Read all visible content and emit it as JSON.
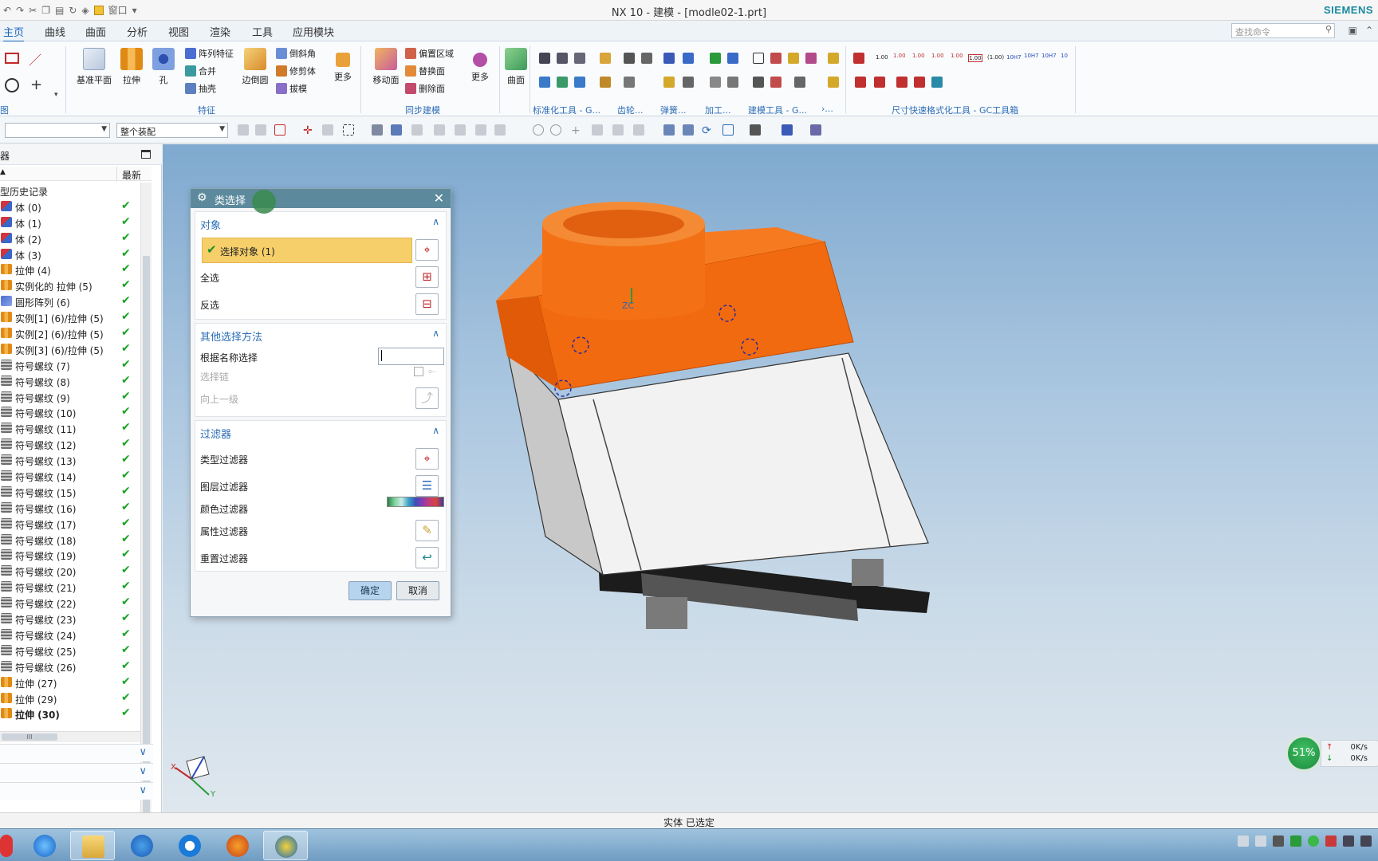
{
  "window": {
    "title": "NX 10 - 建模 - [modle02-1.prt]",
    "brand": "SIEMENS",
    "quick_access_menu": "窗口"
  },
  "menu": {
    "tabs": [
      "主页",
      "曲线",
      "曲面",
      "分析",
      "视图",
      "渲染",
      "工具",
      "应用模块"
    ],
    "active_tab": "主页",
    "search_placeholder": "查找命令"
  },
  "ribbon": {
    "buttons": {
      "datum_plane": "基准平面",
      "extrude": "拉伸",
      "hole": "孔",
      "pattern_feature": "阵列特征",
      "unite": "合并",
      "shell": "抽壳",
      "edge_blend": "边倒圆",
      "chamfer": "倒斜角",
      "trim_body": "修剪体",
      "draft": "拔模",
      "more_feature": "更多",
      "move_face": "移动面",
      "offset_region": "偏置区域",
      "replace_face": "替换面",
      "delete_face": "删除面",
      "more_sync": "更多",
      "surface": "曲面"
    },
    "groups": {
      "direct_sketch": "图",
      "feature": "特征",
      "sync_modeling": "同步建模",
      "std_tools": "标准化工具 - G...",
      "gear": "齿轮...",
      "spring": "弹簧...",
      "machining": "加工...",
      "modeling_tools": "建模工具 - G...",
      "misc": "›...",
      "dim_format": "尺寸快速格式化工具 - GC工具箱"
    },
    "dim_labels": [
      "1.00",
      "1.00",
      "1.00",
      "1.00",
      "1.00",
      "1.00",
      "(1.00)",
      "10H7",
      "10H7",
      "10H7",
      "10"
    ]
  },
  "selection_bar": {
    "filter_value": "",
    "scope_value": "整个装配"
  },
  "navigator": {
    "title": "器",
    "column_name": "▲",
    "column_latest": "最新",
    "root": "型历史记录",
    "items": [
      {
        "label": "体 (0)",
        "type": "body"
      },
      {
        "label": "体 (1)",
        "type": "body"
      },
      {
        "label": "体 (2)",
        "type": "body"
      },
      {
        "label": "体 (3)",
        "type": "body"
      },
      {
        "label": "拉伸 (4)",
        "type": "extrude"
      },
      {
        "label": "实例化的 拉伸 (5)",
        "type": "extrude"
      },
      {
        "label": "圆形阵列 (6)",
        "type": "pattern"
      },
      {
        "label": "实例[1] (6)/拉伸 (5)",
        "type": "extrude"
      },
      {
        "label": "实例[2] (6)/拉伸 (5)",
        "type": "extrude"
      },
      {
        "label": "实例[3] (6)/拉伸 (5)",
        "type": "extrude"
      },
      {
        "label": "符号螺纹 (7)",
        "type": "thread"
      },
      {
        "label": "符号螺纹 (8)",
        "type": "thread"
      },
      {
        "label": "符号螺纹 (9)",
        "type": "thread"
      },
      {
        "label": "符号螺纹 (10)",
        "type": "thread"
      },
      {
        "label": "符号螺纹 (11)",
        "type": "thread"
      },
      {
        "label": "符号螺纹 (12)",
        "type": "thread"
      },
      {
        "label": "符号螺纹 (13)",
        "type": "thread"
      },
      {
        "label": "符号螺纹 (14)",
        "type": "thread"
      },
      {
        "label": "符号螺纹 (15)",
        "type": "thread"
      },
      {
        "label": "符号螺纹 (16)",
        "type": "thread"
      },
      {
        "label": "符号螺纹 (17)",
        "type": "thread"
      },
      {
        "label": "符号螺纹 (18)",
        "type": "thread"
      },
      {
        "label": "符号螺纹 (19)",
        "type": "thread"
      },
      {
        "label": "符号螺纹 (20)",
        "type": "thread"
      },
      {
        "label": "符号螺纹 (21)",
        "type": "thread"
      },
      {
        "label": "符号螺纹 (22)",
        "type": "thread"
      },
      {
        "label": "符号螺纹 (23)",
        "type": "thread"
      },
      {
        "label": "符号螺纹 (24)",
        "type": "thread"
      },
      {
        "label": "符号螺纹 (25)",
        "type": "thread"
      },
      {
        "label": "符号螺纹 (26)",
        "type": "thread"
      },
      {
        "label": "拉伸 (27)",
        "type": "extrude"
      },
      {
        "label": "拉伸 (29)",
        "type": "extrude"
      },
      {
        "label": "拉伸 (30)",
        "type": "extrude",
        "bold": true
      }
    ],
    "hscroll_label": "III"
  },
  "dialog": {
    "title": "类选择",
    "section_object": "对象",
    "select_object": "选择对象 (1)",
    "select_all": "全选",
    "invert": "反选",
    "section_other": "其他选择方法",
    "by_name": "根据名称选择",
    "name_value": "",
    "select_chain": "选择链",
    "up_one_level": "向上一级",
    "section_filter": "过滤器",
    "type_filter": "类型过滤器",
    "layer_filter": "图层过滤器",
    "color_filter": "颜色过滤器",
    "attribute_filter": "属性过滤器",
    "reset_filter": "重置过滤器",
    "ok": "确定",
    "cancel": "取消"
  },
  "status": {
    "text": "实体 已选定"
  },
  "speed_widget": {
    "percent": "51%",
    "up": "0K/s",
    "down": "0K/s"
  },
  "viewport": {
    "triad_x": "X",
    "triad_y": "Y",
    "csys_z": "ZC"
  },
  "colors": {
    "accent": "#1564b8",
    "dialog_header": "#5c8a9c",
    "selected_row": "#f6cf6b",
    "model_orange": "#f36d12",
    "check_green": "#1aa326"
  }
}
